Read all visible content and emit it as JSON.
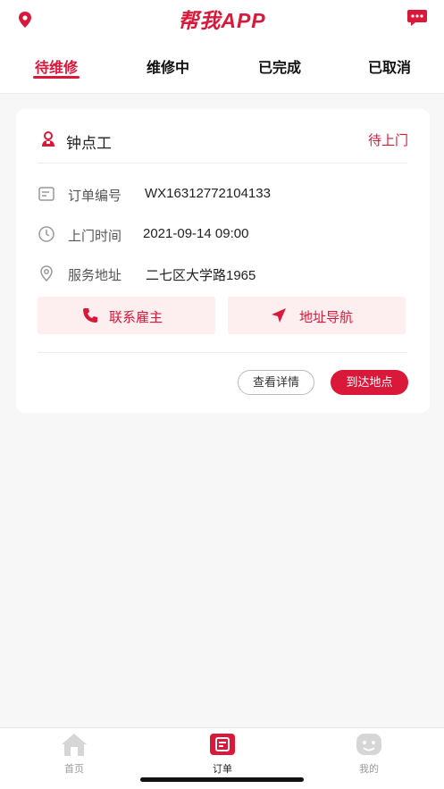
{
  "header": {
    "title": "帮我APP",
    "left_icon": "location-pin-icon",
    "right_icon": "chat-icon"
  },
  "tabs": [
    {
      "label": "待维修",
      "active": true
    },
    {
      "label": "维修中",
      "active": false
    },
    {
      "label": "已完成",
      "active": false
    },
    {
      "label": "已取消",
      "active": false
    }
  ],
  "order": {
    "service_name": "钟点工",
    "status": "待上门",
    "order_no_label": "订单编号",
    "order_no": "WX16312772104133",
    "visit_time_label": "上门时间",
    "visit_time": "2021-09-14 09:00",
    "address_label": "服务地址",
    "address": "二七区大学路1965",
    "contact_label": "联系雇主",
    "navigate_label": "地址导航",
    "detail_label": "查看详情",
    "arrive_label": "到达地点"
  },
  "tabbar": [
    {
      "label": "首页",
      "icon": "home-icon",
      "active": false
    },
    {
      "label": "订单",
      "icon": "order-icon",
      "active": true
    },
    {
      "label": "我的",
      "icon": "profile-icon",
      "active": false
    }
  ],
  "colors": {
    "accent": "#d9183a",
    "accent_soft": "#fdeef0",
    "background": "#f7f7f7"
  }
}
